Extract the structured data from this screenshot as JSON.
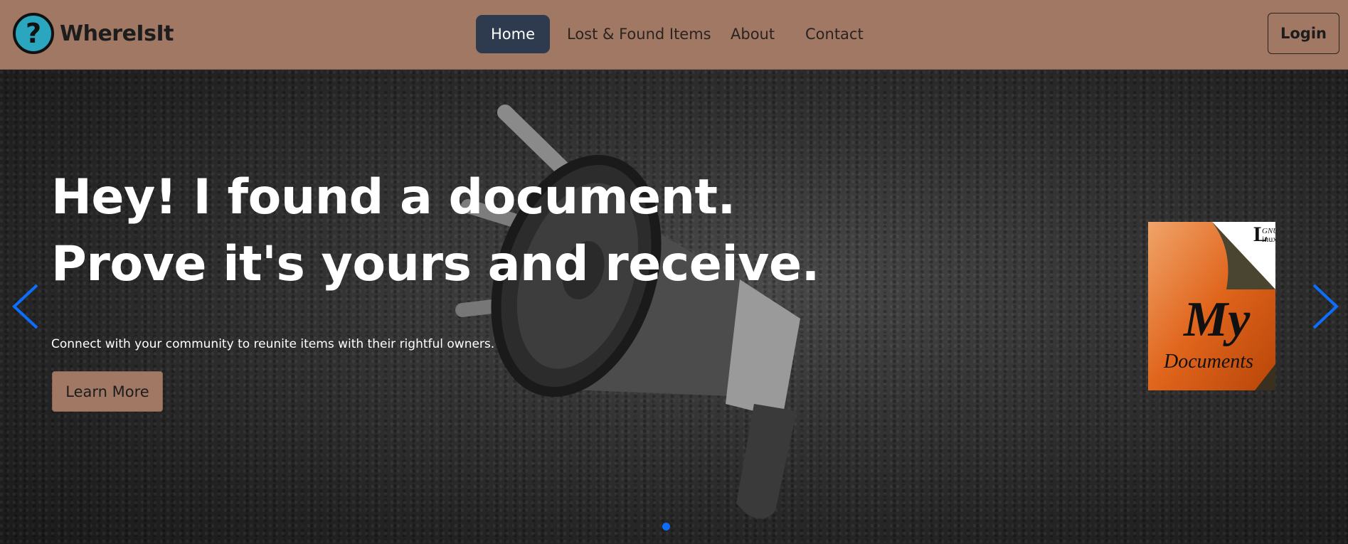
{
  "brand": {
    "name": "WhereIsIt",
    "logo_icon": "question-mark-icon",
    "logo_color": "#2aa7bf"
  },
  "nav": {
    "items": [
      {
        "label": "Home",
        "active": true
      },
      {
        "label": "Lost & Found Items"
      },
      {
        "label": "About"
      },
      {
        "label": "Contact"
      }
    ],
    "login_label": "Login",
    "bg_color": "#a07864",
    "active_color": "#2e3a4d"
  },
  "hero": {
    "title_line1": "Hey! I found a document.",
    "title_line2": "Prove it's yours and receive.",
    "subtitle": "Connect with your community to reunite items with their rightful owners.",
    "cta_label": "Learn More",
    "background_icon": "megaphone-icon",
    "side_image": {
      "icon": "my-documents-icon",
      "big_text": "My",
      "small_text": "Documents",
      "corner_top": "GNU",
      "corner_main": "L",
      "corner_rest": "inux"
    },
    "prev_icon": "chevron-left-icon",
    "next_icon": "chevron-right-icon",
    "accent_color": "#0d6efd"
  }
}
